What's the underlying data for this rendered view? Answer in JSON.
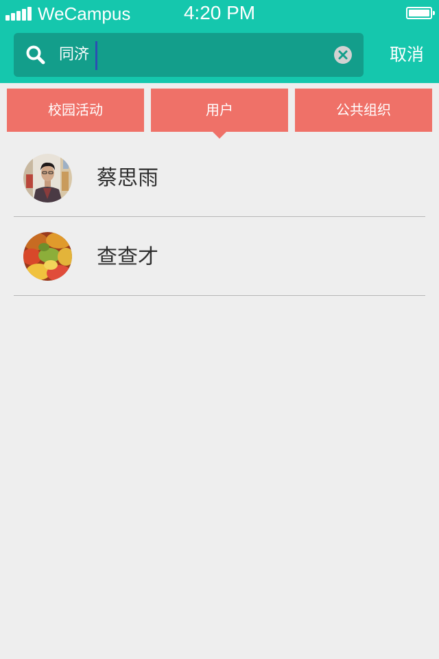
{
  "status_bar": {
    "carrier": "WeCampus",
    "time": "4:20 PM"
  },
  "search": {
    "query": "同济",
    "cancel_label": "取消"
  },
  "tabs": [
    {
      "label": "校园活动"
    },
    {
      "label": "用户",
      "selected": true
    },
    {
      "label": "公共组织"
    }
  ],
  "results": [
    {
      "name": "蔡思雨"
    },
    {
      "name": "查查才"
    }
  ],
  "colors": {
    "header": "#15c7ad",
    "search_box": "#139e8b",
    "tab": "#ef7168",
    "background": "#eeeeee",
    "divider": "#b7b7b7"
  },
  "icons": [
    "signal-icon",
    "battery-icon",
    "search-icon",
    "clear-icon",
    "tab-pointer-icon"
  ]
}
